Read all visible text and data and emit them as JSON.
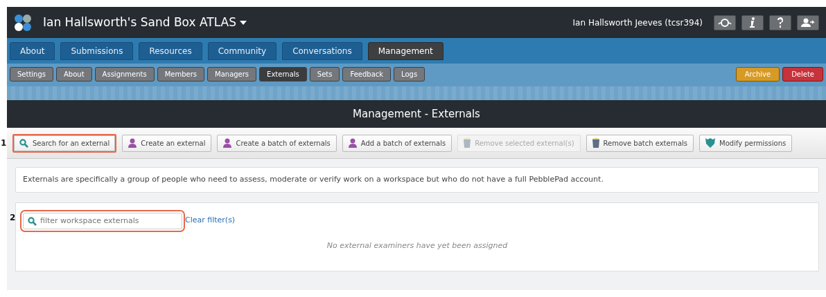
{
  "header": {
    "title": "Ian Hallsworth's Sand Box ATLAS",
    "user": "Ian Hallsworth Jeeves (tcsr394)"
  },
  "main_tabs": [
    {
      "label": "About",
      "selected": false
    },
    {
      "label": "Submissions",
      "selected": false
    },
    {
      "label": "Resources",
      "selected": false
    },
    {
      "label": "Community",
      "selected": false
    },
    {
      "label": "Conversations",
      "selected": false
    },
    {
      "label": "Management",
      "selected": true
    }
  ],
  "sub_tabs": [
    {
      "label": "Settings",
      "selected": false
    },
    {
      "label": "About",
      "selected": false
    },
    {
      "label": "Assignments",
      "selected": false
    },
    {
      "label": "Members",
      "selected": false
    },
    {
      "label": "Managers",
      "selected": false
    },
    {
      "label": "Externals",
      "selected": true
    },
    {
      "label": "Sets",
      "selected": false
    },
    {
      "label": "Feedback",
      "selected": false
    },
    {
      "label": "Logs",
      "selected": false
    }
  ],
  "workspace_actions": [
    {
      "label": "Archive",
      "kind": "warning"
    },
    {
      "label": "Delete",
      "kind": "danger"
    }
  ],
  "panel": {
    "title": "Management - Externals",
    "toolbar_callout": "1",
    "toolbar": [
      {
        "label": "Search for an external",
        "kind": "search",
        "disabled": false,
        "highlighted": true
      },
      {
        "label": "Create an external",
        "kind": "person",
        "disabled": false,
        "highlighted": false
      },
      {
        "label": "Create a batch of externals",
        "kind": "person",
        "disabled": false,
        "highlighted": false
      },
      {
        "label": "Add a batch of externals",
        "kind": "person",
        "disabled": false,
        "highlighted": false
      },
      {
        "label": "Remove selected external(s)",
        "kind": "bin",
        "disabled": true,
        "highlighted": false
      },
      {
        "label": "Remove batch externals",
        "kind": "bin",
        "disabled": false,
        "highlighted": false
      },
      {
        "label": "Modify permissions",
        "kind": "shield",
        "disabled": false,
        "highlighted": false
      }
    ],
    "info": "Externals are specifically a group of people who need to assess, moderate or verify work on a workspace but who do not have a full PebblePad account.",
    "filter_callout": "2",
    "filter": {
      "placeholder": "filter workspace externals",
      "highlighted": true
    },
    "clear_link": "Clear filter(s)",
    "empty_message": "No external examiners have yet been assigned"
  }
}
